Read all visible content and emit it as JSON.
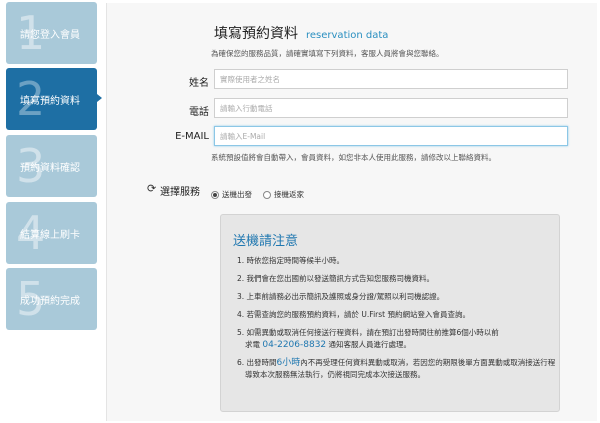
{
  "steps": [
    {
      "num": "1",
      "label": "請您登入會員"
    },
    {
      "num": "2",
      "label": "填寫預約資料"
    },
    {
      "num": "3",
      "label": "預約資料確認"
    },
    {
      "num": "4",
      "label": "結算線上刷卡"
    },
    {
      "num": "5",
      "label": "成功預約完成"
    }
  ],
  "active_step": 2,
  "form": {
    "title": "填寫預約資料",
    "subtitle": "reservation data",
    "intro": "為確保您的服務品質，請確實填寫下列資料，客服人員將會與您聯絡。",
    "name_label": "姓名",
    "name_placeholder": "實際使用者之姓名",
    "phone_label": "電話",
    "phone_placeholder": "請輸入行動電話",
    "email_label": "E-MAIL",
    "email_placeholder": "請輸入E-Mail",
    "hint": "系統預設值將會自動帶入，會員資料，如您非本人使用此服務，請修改以上聯絡資料。",
    "service_label": "選擇服務",
    "service_options": [
      "送機出發",
      "接機返家"
    ],
    "service_selected": 0
  },
  "notice": {
    "title": "送機請注意",
    "items": {
      "i1": "1. 時依您指定時間等候半小時。",
      "i2": "2. 我們會在您出國前以發送簡訊方式告知您服務司機資料。",
      "i3": "3. 上車前請務必出示簡訊及護照或身分證/駕照以利司機認證。",
      "i4": "4. 若需查詢您的服務預約資料，請於 U.First 預約網站登入會員查詢。",
      "i5a": "5. 如需異動或取消任何接送行程資料，請在預訂出發時間往前推算6個小時以前",
      "i5b_pre": "求電",
      "i5b_phone": "04-2206-8832",
      "i5b_post": "通知客服人員進行處理。",
      "i6a_pre": "6. 出發時間",
      "i6a_hl": "6小時",
      "i6a_post": "內不再受理任何資料異動或取消，若因您的期限後單方面異動或取消接送行程",
      "i6b": "導致本次服務無法執行，仍將視同完成本次接送服務。"
    }
  },
  "colors": {
    "step_bg": "#a9c9d9",
    "step_active": "#1e6fa4",
    "accent": "#1f77b0"
  }
}
